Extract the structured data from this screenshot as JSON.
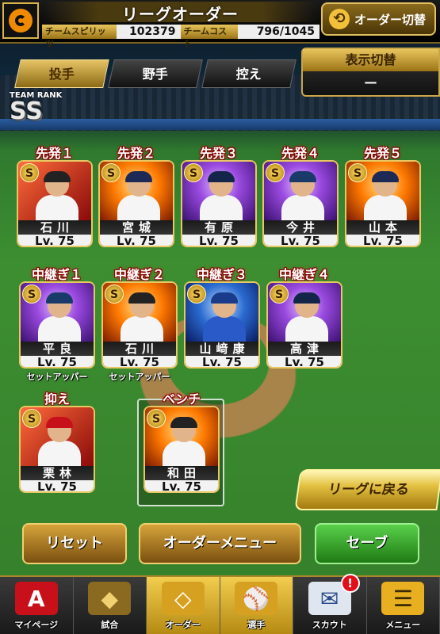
{
  "header": {
    "title": "リーグオーダー",
    "team_spirits_label": "チームスピリッツ",
    "team_spirits_value": "102379",
    "team_cost_label": "チームコスト",
    "team_cost_value": "796/1045",
    "order_switch_label": "オーダー切替"
  },
  "tabs": [
    {
      "label": "投手",
      "active": true
    },
    {
      "label": "野手",
      "active": false
    },
    {
      "label": "控え",
      "active": false
    }
  ],
  "display_toggle": {
    "title": "表示切替",
    "value": "—"
  },
  "team_rank": {
    "label": "TEAM RANK",
    "value": "SS"
  },
  "starters": [
    {
      "slot": "先発１",
      "name": "石川",
      "level": "Lv. 75",
      "rank": "S",
      "bg": "red",
      "cap": "#222",
      "jersey": "#f5f5f5"
    },
    {
      "slot": "先発２",
      "name": "宮城",
      "level": "Lv. 75",
      "rank": "S",
      "bg": "fire",
      "cap": "#1c2a55",
      "jersey": "#f5f5f5"
    },
    {
      "slot": "先発３",
      "name": "有原",
      "level": "Lv. 75",
      "rank": "S",
      "bg": "purple",
      "cap": "#14254a",
      "jersey": "#f5f5f5"
    },
    {
      "slot": "先発４",
      "name": "今井",
      "level": "Lv. 75",
      "rank": "S",
      "bg": "purple",
      "cap": "#1a3a6a",
      "jersey": "#f5f5f5"
    },
    {
      "slot": "先発５",
      "name": "山本",
      "level": "Lv. 75",
      "rank": "S",
      "bg": "fire",
      "cap": "#1c2a55",
      "jersey": "#f5f5f5"
    }
  ],
  "relievers": [
    {
      "slot": "中継ぎ１",
      "name": "平良",
      "level": "Lv. 75",
      "rank": "S",
      "bg": "purple",
      "cap": "#1a3a6a",
      "jersey": "#f5f5f5",
      "role": "セットアッパー"
    },
    {
      "slot": "中継ぎ２",
      "name": "石川",
      "level": "Lv. 75",
      "rank": "S",
      "bg": "fire",
      "cap": "#222",
      "jersey": "#f5f5f5",
      "role": "セットアッパー"
    },
    {
      "slot": "中継ぎ３",
      "name": "山﨑康",
      "level": "Lv. 75",
      "rank": "S",
      "bg": "blue",
      "cap": "#1a3a8a",
      "jersey": "#2a5ac8",
      "role": ""
    },
    {
      "slot": "中継ぎ４",
      "name": "高津",
      "level": "Lv. 75",
      "rank": "S",
      "bg": "purple",
      "cap": "#14254a",
      "jersey": "#f5f5f5",
      "role": ""
    }
  ],
  "closer": {
    "slot": "抑え",
    "name": "栗林",
    "level": "Lv. 75",
    "rank": "S",
    "bg": "red",
    "cap": "#c8101a",
    "jersey": "#f5f5f5"
  },
  "bench": {
    "slot": "ベンチ",
    "name": "和田",
    "level": "Lv. 75",
    "rank": "S",
    "bg": "fire",
    "cap": "#222",
    "jersey": "#f5f5f5"
  },
  "buttons": {
    "back_league": "リーグに戻る",
    "reset": "リセット",
    "order_menu": "オーダーメニュー",
    "save": "セーブ"
  },
  "bottom_nav": [
    {
      "label": "マイページ",
      "icon": "A"
    },
    {
      "label": "試合",
      "icon": "◆"
    },
    {
      "label": "オーダー",
      "icon": "◇",
      "active": true
    },
    {
      "label": "選手",
      "icon": "⚾",
      "active": true
    },
    {
      "label": "スカウト",
      "icon": "✉",
      "badge": "!"
    },
    {
      "label": "メニュー",
      "icon": "☰"
    }
  ]
}
